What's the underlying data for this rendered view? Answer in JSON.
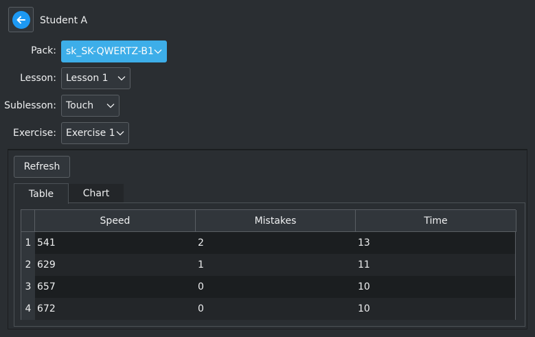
{
  "header": {
    "user_name": "Student A"
  },
  "form": {
    "pack": {
      "label": "Pack:",
      "value": "sk_SK-QWERTZ-B1"
    },
    "lesson": {
      "label": "Lesson:",
      "value": "Lesson 1"
    },
    "sublesson": {
      "label": "Sublesson:",
      "value": "Touch"
    },
    "exercise": {
      "label": "Exercise:",
      "value": "Exercise 1"
    }
  },
  "toolbar": {
    "refresh_label": "Refresh"
  },
  "tabs": [
    {
      "label": "Table",
      "selected": true
    },
    {
      "label": "Chart",
      "selected": false
    }
  ],
  "table": {
    "columns": [
      "Speed",
      "Mistakes",
      "Time"
    ],
    "rows": [
      {
        "index": "1",
        "speed": "541",
        "mistakes": "2",
        "time": "13"
      },
      {
        "index": "2",
        "speed": "629",
        "mistakes": "1",
        "time": "11"
      },
      {
        "index": "3",
        "speed": "657",
        "mistakes": "0",
        "time": "10"
      },
      {
        "index": "4",
        "speed": "672",
        "mistakes": "0",
        "time": "10"
      }
    ]
  },
  "colors": {
    "accent": "#3daee9",
    "back_icon": "#1d99f3",
    "window_bg": "#2a2e32",
    "row_dark": "#1b1e20",
    "row_light": "#232629"
  }
}
